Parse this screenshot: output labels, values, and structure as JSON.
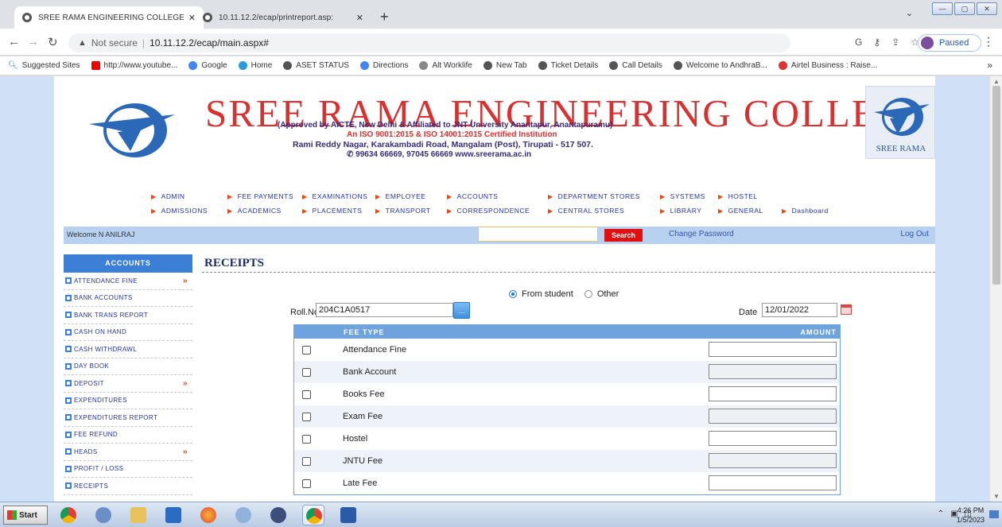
{
  "browser": {
    "tabs": [
      {
        "label": "SREE RAMA ENGINEERING COLLEGE",
        "active": true
      },
      {
        "label": "10.11.12.2/ecap/printreport.asp:",
        "active": false
      }
    ],
    "address": {
      "security": "Not secure",
      "url": "10.11.12.2/ecap/main.aspx#"
    },
    "profile_status": "Paused",
    "bookmarks": [
      {
        "label": "Suggested Sites",
        "icon": "search-icon"
      },
      {
        "label": "http://www.youtube...",
        "icon": "youtube-icon"
      },
      {
        "label": "Google",
        "icon": "google-icon"
      },
      {
        "label": "Home",
        "icon": "home-icon"
      },
      {
        "label": "ASET STATUS",
        "icon": "globe-icon"
      },
      {
        "label": "Directions",
        "icon": "google-icon"
      },
      {
        "label": "Alt Worklife",
        "icon": "worklife-icon"
      },
      {
        "label": "New Tab",
        "icon": "globe-icon"
      },
      {
        "label": "Ticket Details",
        "icon": "globe-icon"
      },
      {
        "label": "Call Details",
        "icon": "globe-icon"
      },
      {
        "label": "Welcome to AndhraB...",
        "icon": "globe-icon"
      },
      {
        "label": "Airtel Business : Raise...",
        "icon": "airtel-icon"
      }
    ],
    "bookmarks_more": "»"
  },
  "header": {
    "college_name": "SREE RAMA ENGINEERING COLLEG",
    "approved": "(Approved by AICTE, New Delhi & Affiliated to JNT University Anantapur, Anantapuramu)",
    "iso": "An ISO 9001:2015 & ISO 14001:2015 Certified Institution",
    "address": "Rami Reddy Nagar, Karakambadi Road, Mangalam (Post), Tirupati - 517 507.",
    "contact": "99634 66669, 97045 66669   www.sreerama.ac.in",
    "logo_text": "SREE RAMA"
  },
  "topnav": {
    "row1": [
      "ADMIN",
      "FEE PAYMENTS",
      "EXAMINATIONS",
      "EMPLOYEE",
      "ACCOUNTS",
      "DEPARTMENT STORES",
      "SYSTEMS",
      "HOSTEL"
    ],
    "row2": [
      "ADMISSIONS",
      "ACADEMICS",
      "PLACEMENTS",
      "TRANSPORT",
      "CORRESPONDENCE",
      "CENTRAL STORES",
      "LIBRARY",
      "GENERAL",
      "Dashboard"
    ]
  },
  "welcome_bar": {
    "welcome": "Welcome N ANILRAJ",
    "search_value": "",
    "search_label": "Search",
    "change_password": "Change Password",
    "logout": "Log Out"
  },
  "sidebar": {
    "heading": "ACCOUNTS",
    "items": [
      {
        "label": "ATTENDANCE FINE",
        "submenu": true
      },
      {
        "label": "BANK ACCOUNTS",
        "submenu": false
      },
      {
        "label": "BANK TRANS REPORT",
        "submenu": false
      },
      {
        "label": "CASH ON HAND",
        "submenu": false
      },
      {
        "label": "CASH WITHDRAWL",
        "submenu": false
      },
      {
        "label": "DAY BOOK",
        "submenu": false
      },
      {
        "label": "DEPOSIT",
        "submenu": true
      },
      {
        "label": "EXPENDITURES",
        "submenu": false
      },
      {
        "label": "EXPENDITURES REPORT",
        "submenu": false
      },
      {
        "label": "FEE REFUND",
        "submenu": false
      },
      {
        "label": "HEADS",
        "submenu": true
      },
      {
        "label": "PROFIT / LOSS",
        "submenu": false
      },
      {
        "label": "RECEIPTS",
        "submenu": false
      }
    ],
    "submenu_marker": "»"
  },
  "receipts": {
    "title": "RECEIPTS",
    "radio_options": [
      {
        "label": "From student",
        "selected": true
      },
      {
        "label": "Other",
        "selected": false
      }
    ],
    "roll_label": "Roll.No",
    "roll_value": "204C1A0517",
    "roll_button": "...",
    "date_label": "Date",
    "date_value": "12/01/2022",
    "table_headers": {
      "fee_type": "FEE TYPE",
      "amount": "AMOUNT"
    },
    "fees": [
      {
        "name": "Attendance Fine",
        "amount": "",
        "disabled": false
      },
      {
        "name": "Bank Account",
        "amount": "",
        "disabled": true
      },
      {
        "name": "Books Fee",
        "amount": "",
        "disabled": false
      },
      {
        "name": "Exam Fee",
        "amount": "",
        "disabled": true
      },
      {
        "name": "Hostel",
        "amount": "",
        "disabled": false
      },
      {
        "name": "JNTU Fee",
        "amount": "",
        "disabled": true
      },
      {
        "name": "Late Fee",
        "amount": "",
        "disabled": false
      }
    ]
  },
  "taskbar": {
    "start_label": "Start",
    "time": "4:26 PM",
    "date": "1/5/2023"
  }
}
